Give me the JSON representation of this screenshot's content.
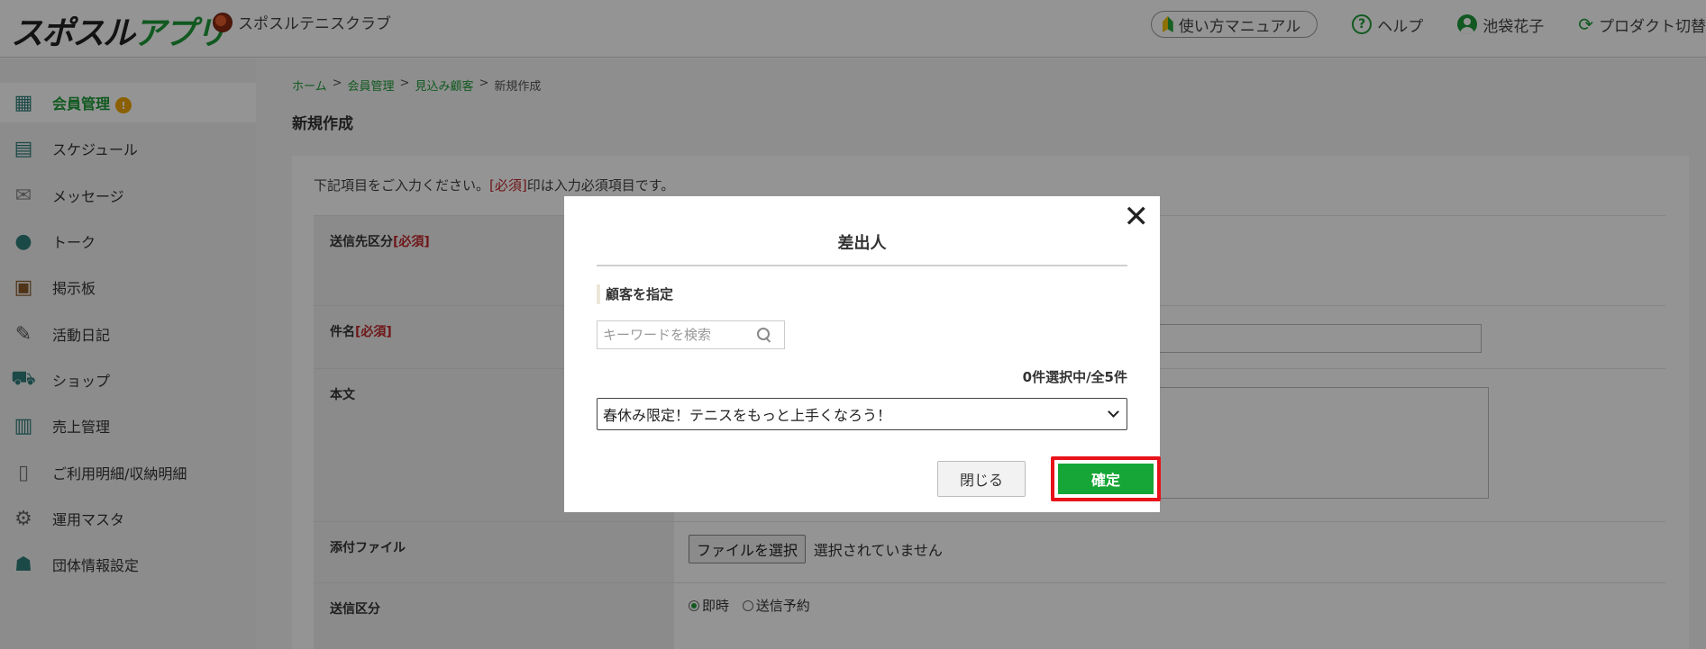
{
  "header": {
    "logo": "スポスルアプリ",
    "club_name": "スポスルテニスクラブ",
    "manual_label": "使い方マニュアル",
    "help_label": "ヘルプ",
    "user_name": "池袋花子",
    "product_label": "プロダクト切替"
  },
  "sidebar": {
    "items": [
      {
        "label": "会員管理",
        "icon": "members-icon",
        "badge": "!"
      },
      {
        "label": "スケジュール",
        "icon": "calendar-icon"
      },
      {
        "label": "メッセージ",
        "icon": "envelope-icon"
      },
      {
        "label": "トーク",
        "icon": "chat-bubble-icon"
      },
      {
        "label": "掲示板",
        "icon": "board-icon"
      },
      {
        "label": "活動日記",
        "icon": "diary-icon"
      },
      {
        "label": "ショップ",
        "icon": "cart-icon"
      },
      {
        "label": "売上管理",
        "icon": "sales-icon"
      },
      {
        "label": "ご利用明細/収納明細",
        "icon": "statement-icon"
      },
      {
        "label": "運用マスタ",
        "icon": "settings-icon"
      },
      {
        "label": "団体情報設定",
        "icon": "group-icon"
      }
    ]
  },
  "breadcrumb": {
    "home": "ホーム",
    "members": "会員管理",
    "prospects": "見込み顧客",
    "current": "新規作成",
    "sep": ">"
  },
  "page": {
    "title": "新規作成",
    "instruction_pre": "下記項目をご入力ください。",
    "instruction_req": "[必須]",
    "instruction_post": "印は入力必須項目です。"
  },
  "form": {
    "recipient_label": "送信先区分",
    "subject_label": "件名",
    "body_label": "本文",
    "attachment_label": "添付ファイル",
    "send_type_label": "送信区分",
    "required_mark": "[必須]",
    "file_button": "ファイルを選択",
    "file_status": "選択されていません",
    "send_now": "即時",
    "send_scheduled": "送信予約"
  },
  "modal": {
    "title": "差出人",
    "close_symbol": "✕",
    "section_heading": "顧客を指定",
    "search_placeholder": "キーワードを検索",
    "count_text": "0件選択中/全5件",
    "selected_option": "春休み限定！テニスをもっと上手くなろう！",
    "close_button": "閉じる",
    "confirm_button": "確定"
  },
  "colors": {
    "accent": "#1e9a38",
    "confirm": "#16a637",
    "highlight_border": "#e8121a",
    "required": "#c0282b"
  }
}
